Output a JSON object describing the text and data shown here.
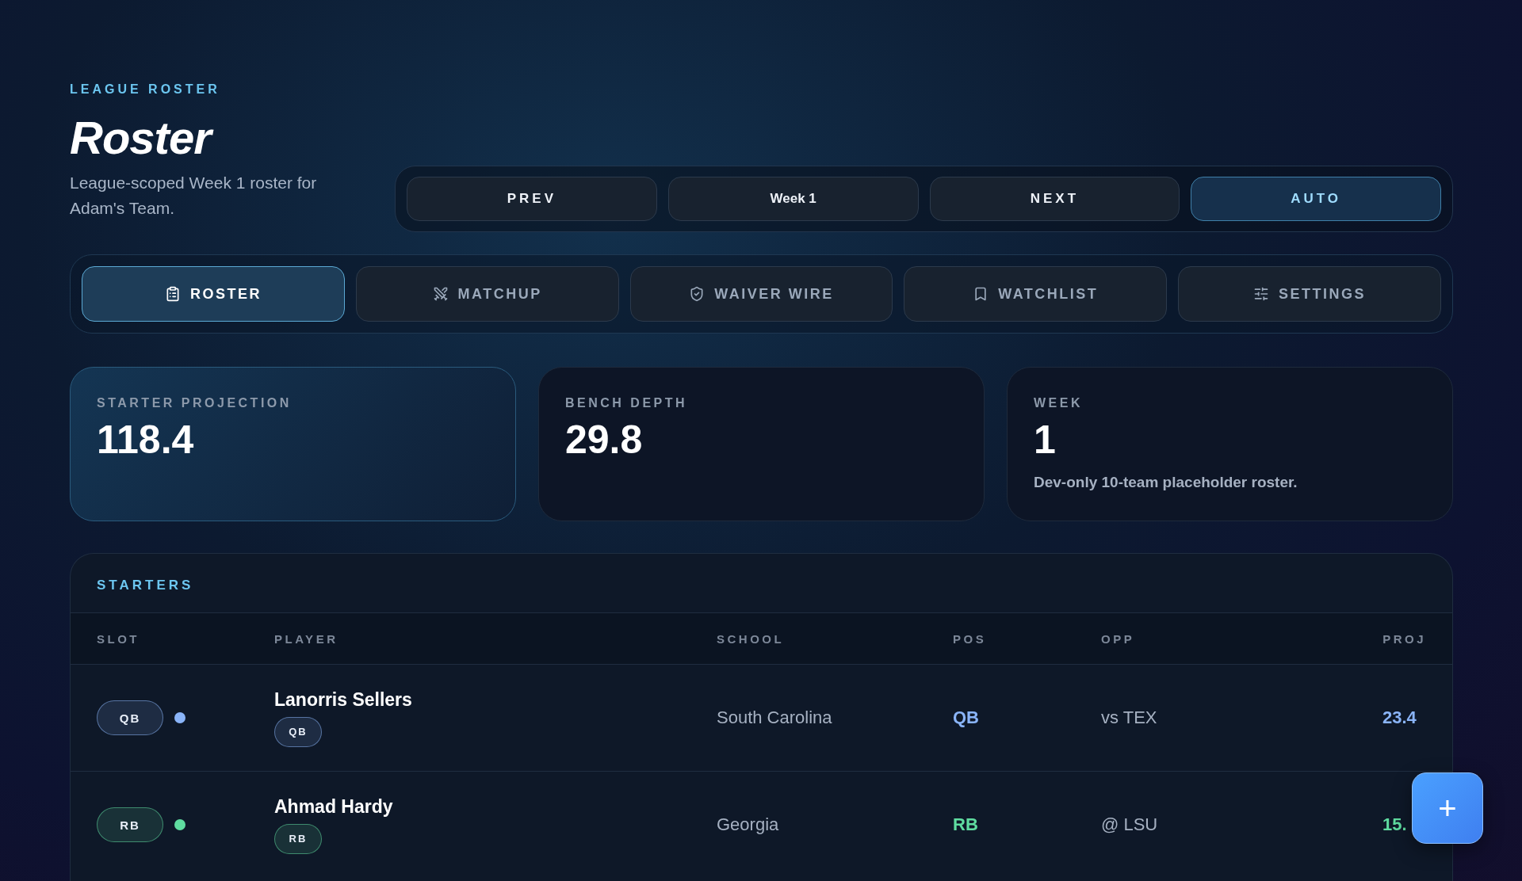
{
  "header": {
    "eyebrow": "LEAGUE ROSTER",
    "title": "Roster",
    "subtitle": "League-scoped Week 1 roster for Adam's Team."
  },
  "week_controls": [
    {
      "kind": "button",
      "label": "PREV",
      "on": false
    },
    {
      "kind": "label",
      "label": "Week 1",
      "on": false
    },
    {
      "kind": "button",
      "label": "NEXT",
      "on": false
    },
    {
      "kind": "button",
      "label": "AUTO",
      "on": true
    }
  ],
  "tabs": [
    {
      "label": "ROSTER",
      "selected": true
    },
    {
      "label": "MATCHUP",
      "selected": false
    },
    {
      "label": "WAIVER WIRE",
      "selected": false
    },
    {
      "label": "WATCHLIST",
      "selected": false
    },
    {
      "label": "SETTINGS",
      "selected": false
    }
  ],
  "stats": [
    {
      "label": "STARTER PROJECTION",
      "value": "118.4",
      "highlight": true
    },
    {
      "label": "BENCH DEPTH",
      "value": "29.8",
      "highlight": false
    },
    {
      "label": "WEEK",
      "value": "1",
      "note": "Dev-only 10-team placeholder roster.",
      "highlight": false
    }
  ],
  "starters": {
    "title": "STARTERS",
    "columns": [
      "SLOT",
      "PLAYER",
      "SCHOOL",
      "POS",
      "OPP",
      "PROJ"
    ],
    "rows": [
      {
        "slot": "QB",
        "color": "#8ab4f8",
        "player": "Lanorris Sellers",
        "badge": "QB",
        "school": "South Carolina",
        "pos": "QB",
        "opp": "vs TEX",
        "proj": "23.4"
      },
      {
        "slot": "RB",
        "color": "#5fdca0",
        "player": "Ahmad Hardy",
        "badge": "RB",
        "school": "Georgia",
        "pos": "RB",
        "opp": "@ LSU",
        "proj": "15."
      }
    ]
  },
  "fab": {
    "label": "+"
  }
}
